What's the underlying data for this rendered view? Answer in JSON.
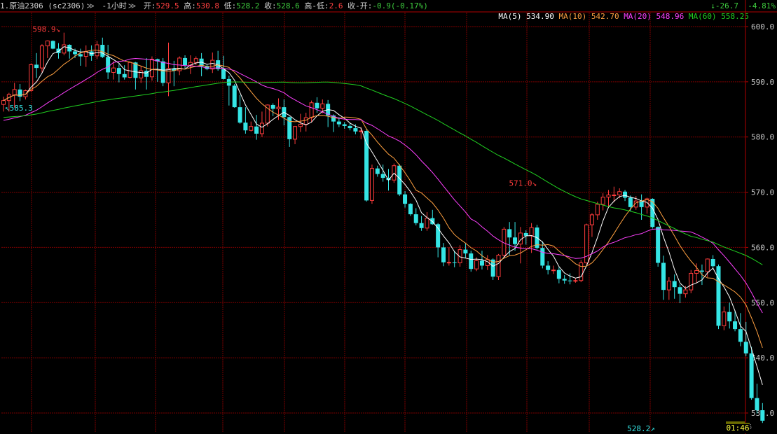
{
  "header": {
    "symbol": "1.原油2306 (sc2306)",
    "period": "1小时",
    "open_label": "开:",
    "open": "529.5",
    "high_label": "高:",
    "high": "530.8",
    "low_label": "低:",
    "low": "528.2",
    "close_label": "收:",
    "close": "528.6",
    "range_label": "高-低:",
    "range": "2.6",
    "change_label": "收-开:",
    "change": "-0.9(-0.17%)",
    "change_icon": "arrow-down-icon",
    "total_change": "-26.7",
    "total_change_pct": "-4.81%"
  },
  "ma_legend": {
    "ma5": "MA(5) 534.90",
    "ma10": "MA(10) 542.70",
    "ma20": "MA(20) 548.96",
    "ma60": "MA(60) 558.25"
  },
  "clock": "01:46",
  "colors": {
    "up": "#ff3c3c",
    "down": "#35e5e5",
    "grid": "#7a0000",
    "ma5": "#ffffff",
    "ma10": "#ffa040",
    "ma20": "#ff40ff",
    "ma60": "#20d020",
    "axis_text": "#c8c8c8"
  },
  "chart_data": {
    "type": "candlestick",
    "y_ticks": [
      "530.0",
      "540.0",
      "550.0",
      "560.0",
      "570.0",
      "580.0",
      "590.0",
      "600.0"
    ],
    "ylim": [
      527.5,
      602.5
    ],
    "annotations": [
      {
        "text": "598.9",
        "label": "598.9↘",
        "value": 598.9,
        "bar": 11
      },
      {
        "text": "585.3",
        "label": "↖585.3",
        "value": 585.3,
        "bar": 0
      },
      {
        "text": "571.0",
        "label": "571.0↘",
        "value": 571.0,
        "bar": 97
      },
      {
        "text": "528.2",
        "label": "528.2↗",
        "value": 528.2,
        "bar": 119
      }
    ],
    "current_price": "528.6",
    "candles": [
      [
        585.9,
        587.3,
        584.6,
        586.6
      ],
      [
        586.6,
        588.0,
        584.6,
        587.7
      ],
      [
        587.6,
        589.8,
        585.3,
        588.6
      ],
      [
        588.6,
        589.6,
        586.5,
        587.3
      ],
      [
        587.3,
        588.6,
        586.8,
        588.4
      ],
      [
        588.4,
        593.3,
        588.2,
        593.1
      ],
      [
        593.1,
        595.2,
        590.7,
        592.5
      ],
      [
        592.5,
        596.8,
        591.7,
        596.5
      ],
      [
        596.5,
        597.5,
        594.3,
        597.4
      ],
      [
        597.4,
        597.5,
        595.9,
        596.0
      ],
      [
        596.0,
        597.0,
        594.2,
        595.2
      ],
      [
        595.2,
        598.9,
        594.8,
        596.7
      ],
      [
        596.7,
        596.8,
        594.2,
        595.5
      ],
      [
        595.5,
        596.0,
        594.3,
        595.0
      ],
      [
        595.0,
        596.0,
        592.9,
        594.6
      ],
      [
        594.6,
        596.6,
        592.7,
        595.5
      ],
      [
        595.5,
        596.6,
        593.8,
        594.7
      ],
      [
        594.7,
        597.4,
        594.1,
        596.7
      ],
      [
        596.7,
        598.0,
        594.3,
        594.5
      ],
      [
        594.5,
        596.7,
        590.5,
        591.7
      ],
      [
        591.7,
        593.7,
        590.4,
        592.5
      ],
      [
        592.5,
        593.2,
        589.9,
        591.4
      ],
      [
        591.4,
        593.0,
        590.4,
        590.8
      ],
      [
        590.8,
        593.6,
        590.6,
        593.5
      ],
      [
        593.5,
        593.6,
        588.6,
        590.7
      ],
      [
        590.7,
        592.9,
        589.8,
        592.0
      ],
      [
        592.0,
        594.3,
        588.6,
        590.9
      ],
      [
        590.9,
        594.6,
        590.2,
        594.1
      ],
      [
        594.1,
        594.2,
        590.0,
        593.7
      ],
      [
        593.7,
        594.3,
        589.2,
        589.8
      ],
      [
        589.8,
        597.1,
        587.4,
        592.4
      ],
      [
        592.4,
        593.8,
        589.2,
        592.0
      ],
      [
        592.0,
        594.6,
        591.2,
        594.3
      ],
      [
        594.3,
        594.8,
        592.4,
        593.0
      ],
      [
        593.0,
        594.8,
        591.4,
        593.5
      ],
      [
        593.5,
        594.6,
        593.0,
        594.2
      ],
      [
        594.2,
        595.2,
        591.0,
        592.8
      ],
      [
        592.8,
        593.1,
        592.1,
        592.3
      ],
      [
        592.3,
        595.3,
        591.6,
        593.9
      ],
      [
        593.9,
        595.6,
        592.0,
        592.3
      ],
      [
        592.3,
        594.7,
        590.4,
        590.5
      ],
      [
        590.5,
        591.1,
        585.7,
        589.3
      ],
      [
        589.3,
        589.6,
        585.3,
        585.4
      ],
      [
        585.4,
        587.6,
        582.4,
        582.6
      ],
      [
        582.6,
        585.4,
        580.6,
        581.2
      ],
      [
        581.2,
        582.8,
        581.0,
        581.9
      ],
      [
        581.9,
        584.0,
        579.5,
        580.6
      ],
      [
        580.6,
        584.6,
        580.0,
        582.5
      ],
      [
        582.5,
        585.9,
        581.9,
        585.8
      ],
      [
        585.8,
        586.1,
        583.8,
        585.1
      ],
      [
        585.1,
        587.0,
        583.1,
        585.4
      ],
      [
        585.4,
        586.8,
        582.1,
        583.6
      ],
      [
        583.6,
        583.7,
        578.2,
        579.6
      ],
      [
        579.6,
        582.0,
        578.7,
        581.9
      ],
      [
        581.9,
        584.2,
        580.9,
        582.3
      ],
      [
        582.3,
        584.4,
        581.0,
        583.5
      ],
      [
        583.5,
        586.6,
        582.6,
        586.2
      ],
      [
        586.2,
        587.2,
        584.4,
        585.2
      ],
      [
        585.2,
        586.8,
        584.3,
        586.0
      ],
      [
        586.0,
        586.7,
        581.8,
        583.9
      ],
      [
        583.9,
        584.1,
        580.9,
        582.8
      ],
      [
        582.8,
        583.6,
        581.8,
        582.3
      ],
      [
        582.3,
        582.7,
        581.5,
        582.0
      ],
      [
        582.0,
        582.5,
        581.2,
        581.6
      ],
      [
        581.6,
        582.3,
        580.5,
        581.0
      ],
      [
        581.0,
        581.8,
        579.6,
        581.1
      ],
      [
        581.1,
        581.5,
        568.3,
        568.5
      ],
      [
        568.5,
        575.0,
        567.9,
        574.3
      ],
      [
        574.3,
        574.8,
        572.8,
        573.3
      ],
      [
        573.3,
        575.0,
        571.9,
        572.6
      ],
      [
        572.6,
        574.2,
        570.3,
        572.2
      ],
      [
        572.2,
        575.2,
        571.7,
        574.8
      ],
      [
        574.8,
        575.1,
        569.3,
        569.6
      ],
      [
        569.6,
        570.2,
        567.2,
        567.9
      ],
      [
        567.9,
        568.0,
        565.7,
        566.0
      ],
      [
        566.0,
        567.1,
        564.0,
        564.4
      ],
      [
        564.4,
        565.7,
        563.0,
        563.5
      ],
      [
        563.5,
        566.4,
        563.0,
        565.3
      ],
      [
        565.3,
        566.8,
        564.1,
        564.2
      ],
      [
        564.2,
        564.4,
        558.2,
        560.0
      ],
      [
        560.0,
        560.8,
        556.6,
        557.3
      ],
      [
        557.3,
        560.0,
        556.7,
        557.3
      ],
      [
        557.3,
        559.4,
        556.4,
        557.2
      ],
      [
        557.2,
        560.4,
        556.5,
        559.6
      ],
      [
        559.6,
        560.7,
        558.1,
        558.9
      ],
      [
        558.9,
        559.4,
        555.6,
        556.1
      ],
      [
        556.1,
        558.2,
        555.7,
        557.6
      ],
      [
        557.6,
        559.4,
        556.0,
        556.7
      ],
      [
        556.7,
        558.6,
        555.9,
        557.8
      ],
      [
        557.8,
        558.0,
        554.1,
        554.7
      ],
      [
        554.7,
        558.8,
        554.1,
        558.6
      ],
      [
        558.6,
        563.7,
        558.2,
        563.3
      ],
      [
        563.3,
        564.6,
        558.6,
        561.8
      ],
      [
        561.8,
        564.6,
        559.4,
        560.6
      ],
      [
        560.6,
        563.7,
        557.1,
        562.6
      ],
      [
        562.6,
        563.1,
        560.5,
        562.1
      ],
      [
        562.1,
        564.4,
        559.0,
        563.6
      ],
      [
        563.6,
        564.1,
        559.6,
        559.9
      ],
      [
        559.9,
        561.1,
        556.2,
        556.7
      ],
      [
        556.7,
        557.5,
        555.1,
        555.9
      ],
      [
        555.9,
        556.7,
        555.2,
        555.9
      ],
      [
        555.9,
        556.4,
        553.5,
        554.3
      ],
      [
        554.3,
        555.0,
        553.4,
        554.0
      ],
      [
        554.0,
        555.3,
        553.3,
        553.9
      ],
      [
        553.9,
        554.4,
        553.6,
        554.0
      ],
      [
        554.0,
        557.7,
        553.7,
        557.2
      ],
      [
        557.2,
        564.3,
        556.9,
        564.1
      ],
      [
        564.1,
        566.2,
        561.9,
        565.9
      ],
      [
        565.9,
        568.3,
        565.0,
        567.8
      ],
      [
        567.8,
        569.8,
        566.7,
        569.1
      ],
      [
        569.1,
        570.4,
        567.3,
        569.5
      ],
      [
        569.5,
        571.0,
        568.2,
        569.5
      ],
      [
        569.5,
        570.7,
        568.9,
        570.1
      ],
      [
        570.1,
        570.4,
        568.4,
        569.0
      ],
      [
        569.0,
        569.4,
        566.6,
        567.3
      ],
      [
        567.3,
        569.3,
        566.8,
        568.4
      ],
      [
        568.4,
        569.6,
        565.0,
        567.3
      ],
      [
        567.3,
        569.0,
        566.1,
        568.8
      ],
      [
        568.8,
        568.9,
        563.4,
        563.7
      ],
      [
        563.7,
        563.8,
        556.5,
        557.2
      ],
      [
        557.2,
        558.5,
        550.5,
        552.3
      ],
      [
        552.3,
        554.6,
        550.5,
        553.9
      ],
      [
        553.9,
        555.1,
        550.7,
        552.8
      ],
      [
        552.8,
        553.3,
        549.9,
        551.6
      ],
      [
        551.6,
        553.0,
        550.9,
        552.3
      ],
      [
        552.3,
        555.9,
        551.7,
        555.3
      ],
      [
        555.3,
        557.1,
        553.5,
        555.8
      ],
      [
        555.8,
        556.9,
        553.2,
        555.6
      ],
      [
        555.6,
        558.0,
        554.6,
        557.9
      ],
      [
        557.9,
        558.6,
        556.3,
        556.6
      ],
      [
        556.6,
        556.9,
        545.2,
        545.8
      ],
      [
        545.8,
        549.3,
        545.0,
        548.3
      ],
      [
        548.3,
        550.0,
        545.3,
        546.6
      ],
      [
        546.6,
        548.6,
        544.8,
        545.2
      ],
      [
        545.2,
        548.1,
        542.1,
        542.9
      ],
      [
        542.9,
        546.5,
        540.3,
        540.8
      ],
      [
        540.8,
        542.0,
        532.4,
        532.7
      ],
      [
        532.7,
        535.3,
        529.9,
        530.5
      ],
      [
        530.5,
        531.8,
        528.2,
        528.6
      ]
    ]
  }
}
